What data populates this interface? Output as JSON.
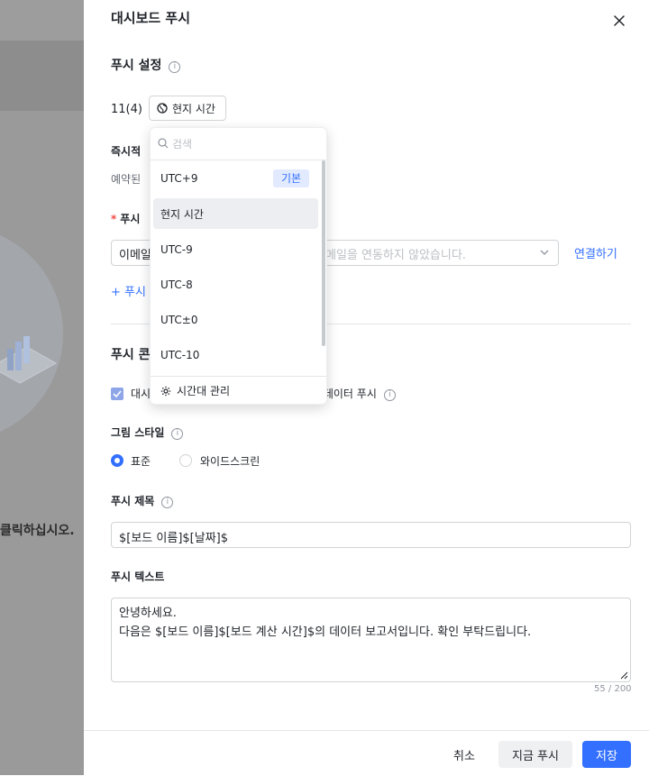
{
  "background": {
    "cta_text": "클릭하십시오."
  },
  "drawer": {
    "title": "대시보드 푸시",
    "push_settings": {
      "title": "푸시 설정",
      "frequency": "11(4)",
      "timezone_button": "현지 시간"
    },
    "immediate": {
      "label_partial": "즉시적 ",
      "desc_partial": "예약된 "
    },
    "push_channel": {
      "required_mark": "*",
      "label_partial": "푸시 ",
      "select_value_partial": "이메일",
      "select_placeholder": "메일을 연동하지 않았습니다.",
      "connect_link": "연결하기",
      "add_link_partial": "+ 푸시"
    },
    "push_content": {
      "title_partial": "푸시 콘",
      "checkbox_label_left": "대시",
      "checkbox_label_right": "드 데이터 푸시"
    },
    "image_style": {
      "title": "그림 스타일",
      "options": [
        "표준",
        "와이드스크린"
      ],
      "selected": "표준"
    },
    "push_title": {
      "label": "푸시 제목",
      "value": "$[보드 이름]$[날짜]$"
    },
    "push_text": {
      "label": "푸시 텍스트",
      "line1": "안녕하세요.",
      "line2": "다음은 $[보드 이름]$[보드 계산 시간]$의 데이터 보고서입니다. 확인 부탁드립니다.",
      "counter": "55 / 200"
    },
    "footer": {
      "cancel": "취소",
      "push_now": "지금 푸시",
      "save": "저장"
    }
  },
  "dropdown": {
    "search_placeholder": "검색",
    "items": [
      "UTC+9",
      "현지 시간",
      "UTC-9",
      "UTC-8",
      "UTC±0",
      "UTC-10"
    ],
    "default_tag": "기본",
    "selected": "현지 시간",
    "manage": "시간대 관리"
  },
  "colors": {
    "accent": "#3370ff",
    "overlay": "#8a8a8a"
  }
}
